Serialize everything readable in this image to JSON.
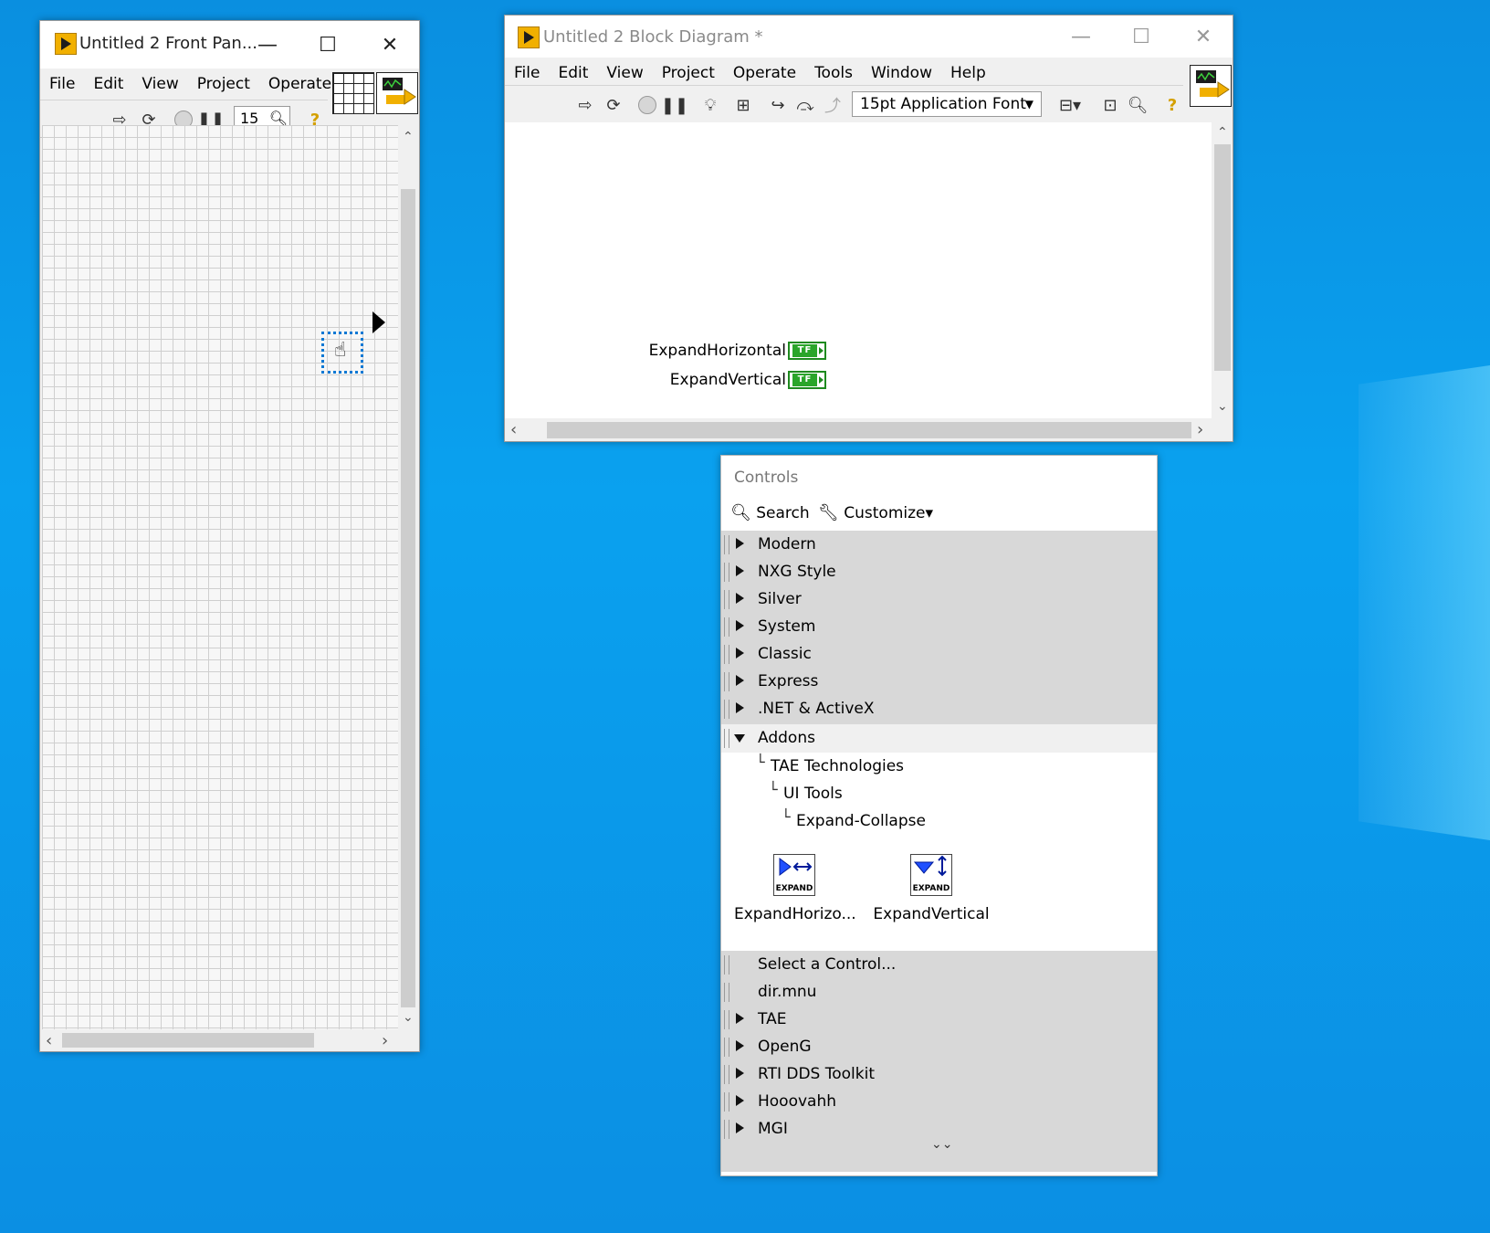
{
  "front_panel": {
    "title": "Untitled 2 Front Pan...",
    "menu": [
      "File",
      "Edit",
      "View",
      "Project",
      "Operate"
    ],
    "font_size_field": "15",
    "help_glyph": "?"
  },
  "block_diagram": {
    "title": "Untitled 2 Block Diagram *",
    "menu": [
      "File",
      "Edit",
      "View",
      "Project",
      "Operate",
      "Tools",
      "Window",
      "Help"
    ],
    "font_dropdown": "15pt Application Font",
    "help_glyph": "?",
    "terminals": [
      {
        "label": "ExpandHorizontal",
        "glyph": "TF"
      },
      {
        "label": "ExpandVertical",
        "glyph": "TF"
      }
    ]
  },
  "controls_palette": {
    "title": "Controls",
    "search_label": "Search",
    "customize_label": "Customize▾",
    "categories": [
      {
        "label": "Modern",
        "expanded": false
      },
      {
        "label": "NXG Style",
        "expanded": false
      },
      {
        "label": "Silver",
        "expanded": false
      },
      {
        "label": "System",
        "expanded": false
      },
      {
        "label": "Classic",
        "expanded": false
      },
      {
        "label": "Express",
        "expanded": false
      },
      {
        "label": ".NET & ActiveX",
        "expanded": false
      },
      {
        "label": "Addons",
        "expanded": true
      }
    ],
    "tree": [
      "TAE Technologies",
      "UI Tools",
      "Expand-Collapse"
    ],
    "items": [
      {
        "caption": "ExpandHorizo...",
        "icon_text": "EXPAND"
      },
      {
        "caption": "ExpandVertical",
        "icon_text": "EXPAND"
      }
    ],
    "bottom_rows": [
      {
        "label": "Select a Control...",
        "has_arrow": false
      },
      {
        "label": "dir.mnu",
        "has_arrow": false
      },
      {
        "label": "TAE",
        "has_arrow": true
      },
      {
        "label": "OpenG",
        "has_arrow": true
      },
      {
        "label": "RTI DDS Toolkit",
        "has_arrow": true
      },
      {
        "label": "Hooovahh",
        "has_arrow": true
      },
      {
        "label": "MGI",
        "has_arrow": true
      }
    ],
    "more_glyph": "⌄⌄"
  },
  "colors": {
    "desktop": "#0aa1ef",
    "selection": "#0a78d4",
    "terminal_green": "#2aa52a",
    "labview_yellow": "#f1b000"
  }
}
